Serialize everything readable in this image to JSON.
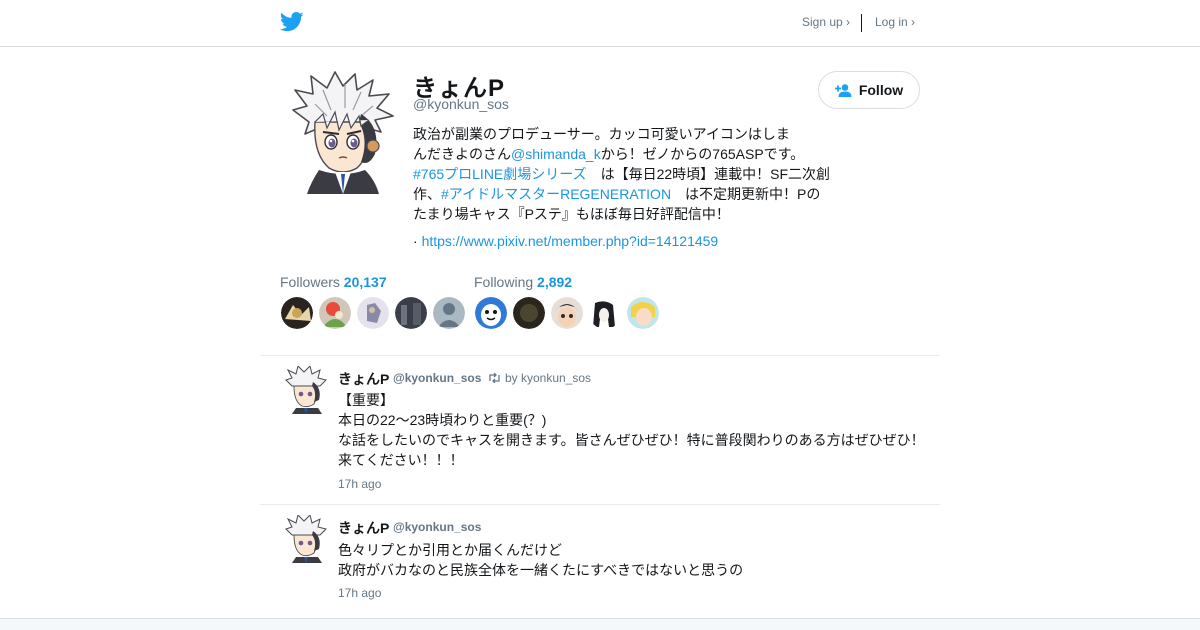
{
  "header": {
    "logo_icon": "twitter-bird-icon",
    "signup_label": "Sign up ›",
    "login_label": "Log in ›",
    "brand_color": "#1da1f2"
  },
  "profile": {
    "name": "きょんP",
    "handle": "@kyonkun_sos",
    "follow_label": "Follow",
    "bio_lines": [
      [
        "政治が副業のプロデューサー。カッコ可愛いアイコンはしま"
      ],
      [
        "んだきよのさん",
        "@shimanda_k",
        "から！ゼノからの765ASPです。"
      ],
      [
        "#765プロLINE劇場シリーズ",
        "　は【毎日22時頃】連載中！SF二次創"
      ],
      [
        "作、",
        "#アイドルマスターREGENERATION",
        "　は不定期更新中！Pの"
      ],
      [
        "たまり場キャス『Pステ』もほぼ毎日好評配信中！"
      ]
    ],
    "url_prefix": "· ",
    "url": "https://www.pixiv.net/member.php?id=14121459"
  },
  "stats": {
    "followers_label": "Followers",
    "followers_count": "20,137",
    "following_label": "Following",
    "following_count": "2,892"
  },
  "tweets": [
    {
      "name": "きょんP",
      "handle": "@kyonkun_sos",
      "retweet_by": "by kyonkun_sos",
      "lines": [
        "【重要】",
        "本日の22～23時頃わりと重要(？)",
        "な話をしたいのでキャスを開きます。皆さんぜひぜひ！特に普段関わりのある方はぜひぜひ！",
        "来てください！！！"
      ],
      "time": "17h ago"
    },
    {
      "name": "きょんP",
      "handle": "@kyonkun_sos",
      "lines": [
        "色々リプとか引用とか届くんだけど",
        "政府がバカなのと民族全体を一緒くたにすべきではないと思うの"
      ],
      "time": "17h ago"
    }
  ]
}
